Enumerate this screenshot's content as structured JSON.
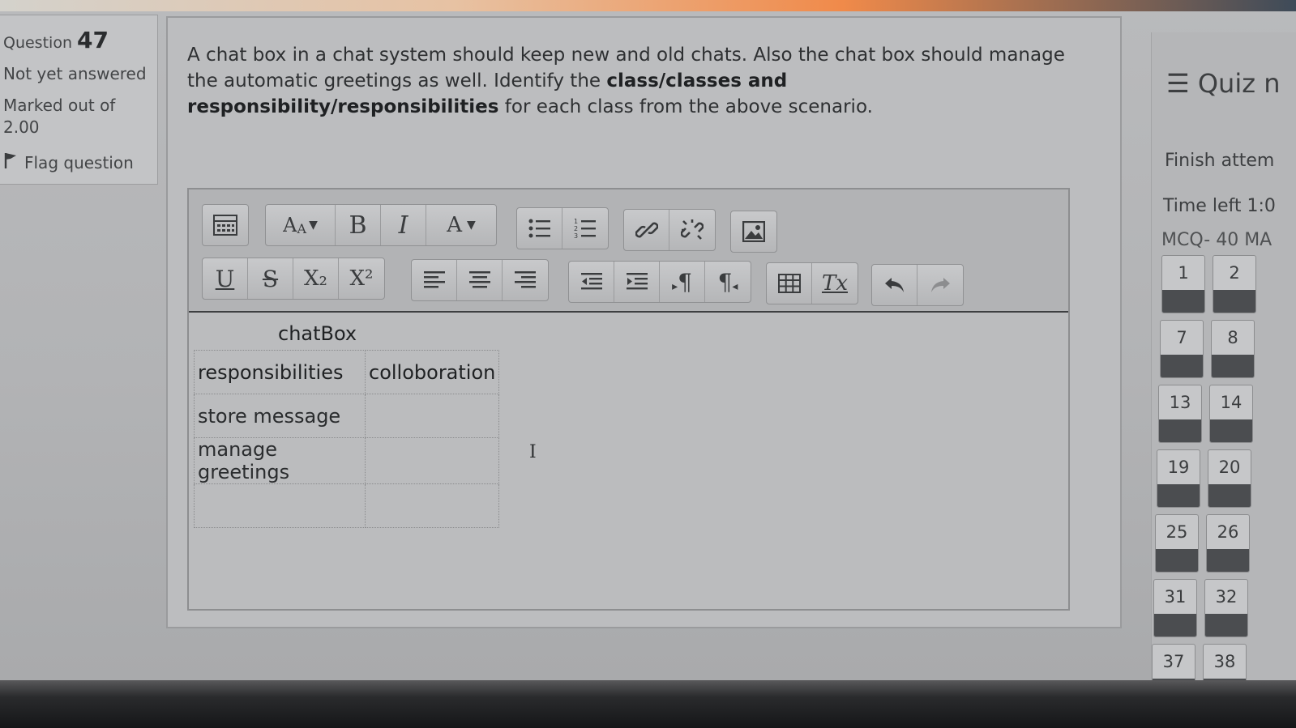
{
  "question": {
    "label": "Question",
    "number": "47",
    "state": "Not yet answered",
    "marked_out_of": "Marked out of 2.00",
    "flag_label": "Flag question",
    "text_part1": "A chat box in a chat system should keep new and old chats. Also the chat box should manage the automatic greetings as well. Identify the ",
    "text_bold": "class/classes and responsibility/responsibilities",
    "text_part2": " for each class from the above scenario."
  },
  "editor": {
    "toolbar_row1": [
      {
        "icon": "toolbar-toggle-icon"
      },
      {
        "icon": "font-size-dropdown-icon",
        "glyph": "A"
      },
      {
        "icon": "bold-icon",
        "glyph": "B"
      },
      {
        "icon": "italic-icon",
        "glyph": "I"
      },
      {
        "icon": "font-color-dropdown-icon",
        "glyph": "A"
      },
      {
        "icon": "unordered-list-icon"
      },
      {
        "icon": "ordered-list-icon"
      },
      {
        "icon": "link-icon"
      },
      {
        "icon": "unlink-icon"
      },
      {
        "icon": "insert-image-icon"
      }
    ],
    "toolbar_row2": [
      {
        "icon": "underline-icon",
        "glyph": "U"
      },
      {
        "icon": "strikethrough-icon",
        "glyph": "S"
      },
      {
        "icon": "subscript-icon",
        "glyph": "X₂"
      },
      {
        "icon": "superscript-icon",
        "glyph": "X²"
      },
      {
        "icon": "align-left-icon"
      },
      {
        "icon": "align-center-icon"
      },
      {
        "icon": "align-right-icon"
      },
      {
        "icon": "outdent-icon"
      },
      {
        "icon": "indent-icon"
      },
      {
        "icon": "ltr-icon",
        "glyph": "¶"
      },
      {
        "icon": "rtl-icon",
        "glyph": "¶"
      },
      {
        "icon": "table-icon"
      },
      {
        "icon": "clear-formatting-icon",
        "glyph": "Tx"
      },
      {
        "icon": "undo-icon"
      },
      {
        "icon": "redo-icon"
      }
    ],
    "content": {
      "class_name": "chatBox",
      "headers": [
        "responsibilities",
        "colloboration"
      ],
      "rows": [
        [
          "store message",
          ""
        ],
        [
          "manage greetings",
          ""
        ],
        [
          "",
          ""
        ]
      ]
    }
  },
  "quiz_nav": {
    "title": "Quiz n",
    "finish": "Finish attem",
    "time_left": "Time left 1:0",
    "section": "MCQ- 40 MA",
    "rows": [
      [
        "1",
        "2"
      ],
      [
        "7",
        "8"
      ],
      [
        "13",
        "14"
      ],
      [
        "19",
        "20"
      ],
      [
        "25",
        "26"
      ],
      [
        "31",
        "32"
      ],
      [
        "37",
        "38"
      ]
    ]
  },
  "colors": {
    "screen_bg": "#b5b6b8",
    "text": "#2e3032",
    "nav_box_bar": "#4b4d50",
    "accent_orange": "#f08a4a"
  }
}
